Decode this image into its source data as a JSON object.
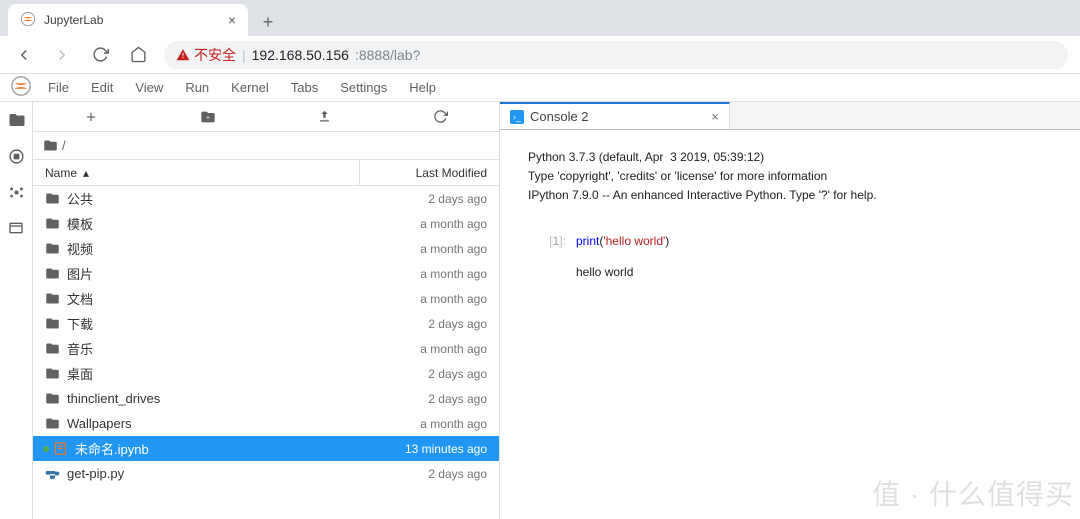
{
  "browser": {
    "tab_title": "JupyterLab",
    "new_tab_glyph": "+",
    "close_glyph": "×",
    "not_secure_label": "不安全",
    "url_host": "192.168.50.156",
    "url_rest": ":8888/lab?"
  },
  "menu": [
    "File",
    "Edit",
    "View",
    "Run",
    "Kernel",
    "Tabs",
    "Settings",
    "Help"
  ],
  "crumb_slash": "/",
  "columns": {
    "name": "Name",
    "modified": "Last Modified"
  },
  "files": [
    {
      "icon": "folder",
      "name": "公共",
      "mod": "2 days ago"
    },
    {
      "icon": "folder",
      "name": "模板",
      "mod": "a month ago"
    },
    {
      "icon": "folder",
      "name": "视频",
      "mod": "a month ago"
    },
    {
      "icon": "folder",
      "name": "图片",
      "mod": "a month ago"
    },
    {
      "icon": "folder",
      "name": "文档",
      "mod": "a month ago"
    },
    {
      "icon": "folder",
      "name": "下载",
      "mod": "2 days ago"
    },
    {
      "icon": "folder",
      "name": "音乐",
      "mod": "a month ago"
    },
    {
      "icon": "folder",
      "name": "桌面",
      "mod": "2 days ago"
    },
    {
      "icon": "folder",
      "name": "thinclient_drives",
      "mod": "2 days ago"
    },
    {
      "icon": "folder",
      "name": "Wallpapers",
      "mod": "a month ago"
    },
    {
      "icon": "notebook",
      "name": "未命名.ipynb",
      "mod": "13 minutes ago",
      "selected": true,
      "running": true
    },
    {
      "icon": "python",
      "name": "get-pip.py",
      "mod": "2 days ago"
    }
  ],
  "console": {
    "tab_label": "Console 2",
    "banner": "Python 3.7.3 (default, Apr  3 2019, 05:39:12)\nType 'copyright', 'credits' or 'license' for more information\nIPython 7.9.0 -- An enhanced Interactive Python. Type '?' for help.",
    "prompt_n": "1",
    "code_fn": "print",
    "code_paren_open": "(",
    "code_str": "'hello world'",
    "code_paren_close": ")",
    "output": "hello world"
  },
  "watermark": "值 · 什么值得买"
}
